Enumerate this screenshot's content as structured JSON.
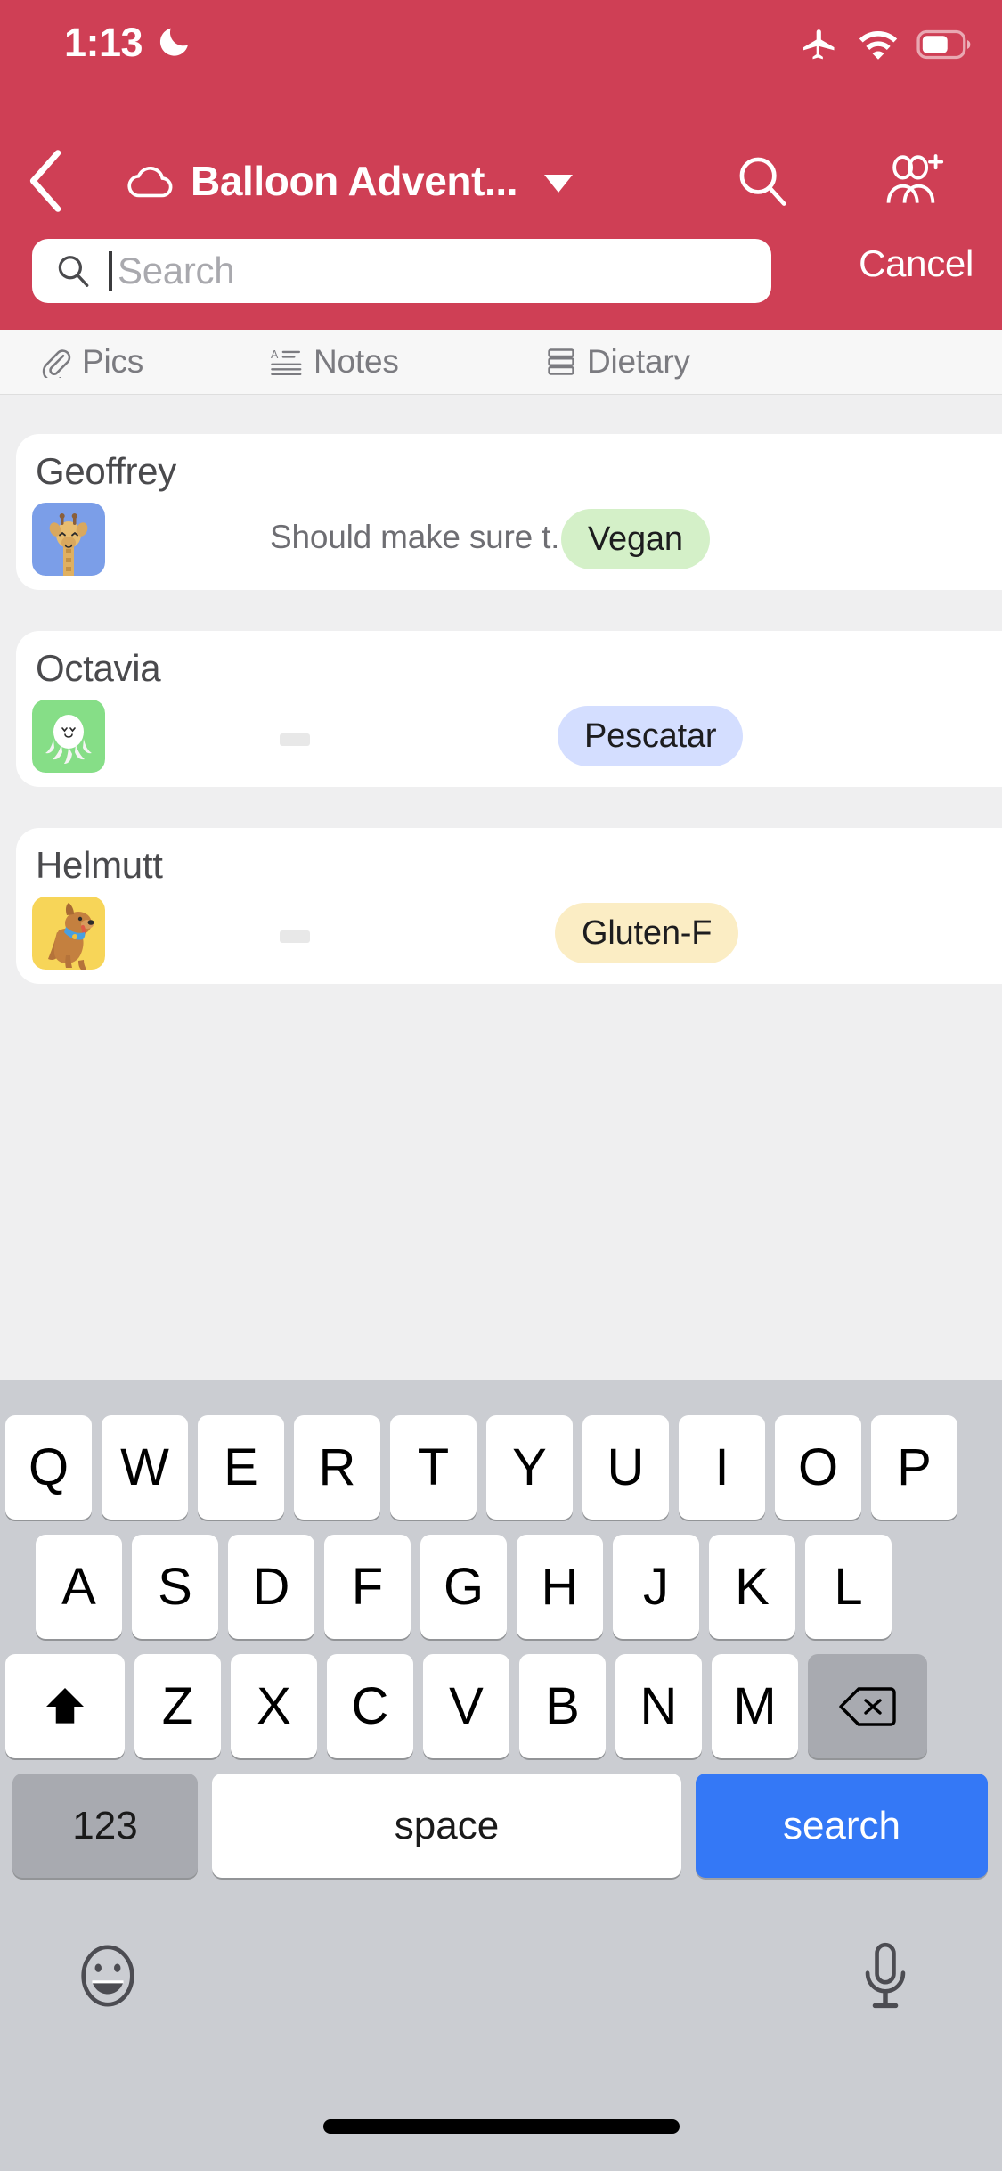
{
  "status_bar": {
    "time": "1:13",
    "icons": [
      "moon-icon",
      "airplane-mode-icon",
      "wifi-icon",
      "battery-icon"
    ]
  },
  "nav": {
    "back_icon": "chevron-left-icon",
    "cloud_icon": "cloud-icon",
    "title": "Balloon Advent...",
    "caret_icon": "chevron-down-icon",
    "search_icon": "search-icon",
    "add_people_icon": "add-people-icon"
  },
  "search": {
    "placeholder": "Search",
    "value": "",
    "icon": "search-icon",
    "cancel_label": "Cancel"
  },
  "tabs": [
    {
      "label": "Pics",
      "icon": "paperclip-icon"
    },
    {
      "label": "Notes",
      "icon": "text-lines-icon"
    },
    {
      "label": "Dietary",
      "icon": "stacked-rows-icon"
    }
  ],
  "list": [
    {
      "name": "Geoffrey",
      "avatar": "giraffe-avatar",
      "avatar_bg": "#7b9ee8",
      "note": "Should make sure t...",
      "note_empty": false,
      "badge": "Vegan",
      "badge_bg": "#d4f0c8"
    },
    {
      "name": "Octavia",
      "avatar": "octopus-avatar",
      "avatar_bg": "#86de87",
      "note": "",
      "note_empty": true,
      "badge": "Pescatar",
      "badge_bg": "#d4deff"
    },
    {
      "name": "Helmutt",
      "avatar": "dog-avatar",
      "avatar_bg": "#f7d558",
      "note": "",
      "note_empty": true,
      "badge": "Gluten-F",
      "badge_bg": "#fbedc4"
    }
  ],
  "keyboard": {
    "row1": [
      "Q",
      "W",
      "E",
      "R",
      "T",
      "Y",
      "U",
      "I",
      "O",
      "P"
    ],
    "row2": [
      "A",
      "S",
      "D",
      "F",
      "G",
      "H",
      "J",
      "K",
      "L"
    ],
    "row3": [
      "Z",
      "X",
      "C",
      "V",
      "B",
      "N",
      "M"
    ],
    "shift_icon": "shift-up-arrow-icon",
    "delete_icon": "delete-backspace-icon",
    "numbers_label": "123",
    "space_label": "space",
    "search_label": "search",
    "emoji_icon": "emoji-smiley-icon",
    "mic_icon": "microphone-icon"
  },
  "colors": {
    "header_red": "#cf3f55",
    "page_bg": "#efeff0",
    "keyboard_bg": "#cbcdd2",
    "search_key_blue": "#3478f6"
  }
}
